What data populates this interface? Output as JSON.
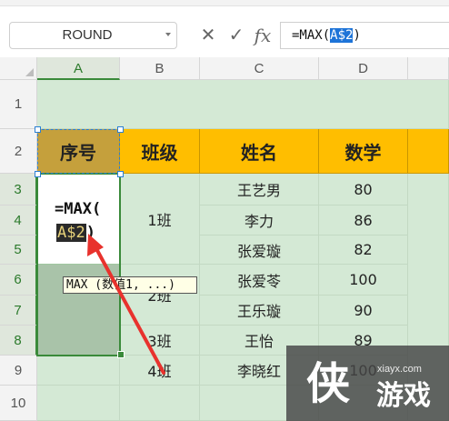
{
  "formula_bar": {
    "name_box": "ROUND",
    "cancel_icon": "✕",
    "confirm_icon": "✓",
    "fx_label": "fx",
    "formula_prefix": "=MAX(",
    "formula_ref": "A$2",
    "formula_suffix": ")"
  },
  "columns": [
    "A",
    "B",
    "C",
    "D"
  ],
  "rows": [
    "1",
    "2",
    "3",
    "4",
    "5",
    "6",
    "7",
    "8",
    "9",
    "10"
  ],
  "header_row": {
    "a": "序号",
    "b": "班级",
    "c": "姓名",
    "d": "数学"
  },
  "classes": [
    "1班",
    "2班",
    "3班",
    "4班"
  ],
  "names": [
    "王艺男",
    "李力",
    "张爱璇",
    "张爱苓",
    "王乐璇",
    "王怡",
    "李晓红"
  ],
  "scores": [
    "80",
    "86",
    "82",
    "100",
    "90",
    "89",
    "100"
  ],
  "edit_cell": {
    "line1": "=MAX(",
    "ref": "A$2",
    "close": ")"
  },
  "tooltip": "MAX (数值1, ...)",
  "watermark": {
    "url": "xiayx.com",
    "char1": "侠",
    "chars": "游戏"
  },
  "colors": {
    "header_yellow": "#ffbe00",
    "header_a": "#c5a03c",
    "cell_green": "#d4e9d5",
    "selection": "#3a8a3a",
    "arrow": "#e8322d"
  }
}
